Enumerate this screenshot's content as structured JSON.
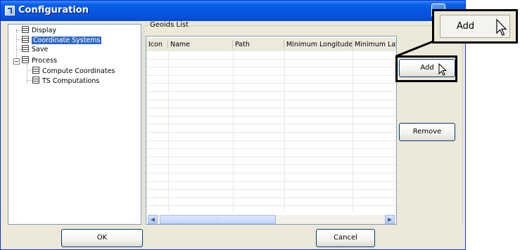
{
  "window": {
    "title": "Configuration"
  },
  "tree": {
    "items": [
      {
        "label": "Display"
      },
      {
        "label": "Coordinate Systems",
        "selected": true
      },
      {
        "label": "Save"
      },
      {
        "label": "Process"
      },
      {
        "label": "Compute Coordinates"
      },
      {
        "label": "TS Computations"
      }
    ]
  },
  "geoids": {
    "group_label": "Geoids List",
    "columns": [
      "Icon",
      "Name",
      "Path",
      "Minimum Longitude",
      "Minimum Lat"
    ]
  },
  "buttons": {
    "add": "Add",
    "remove": "Remove",
    "ok": "OK",
    "cancel": "Cancel"
  },
  "callout": {
    "label": "Add"
  }
}
